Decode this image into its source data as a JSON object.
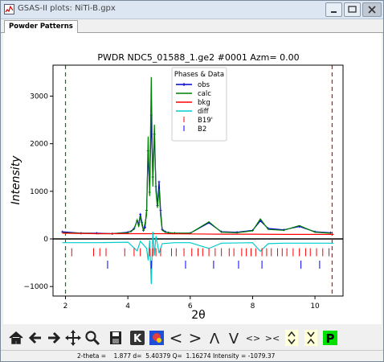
{
  "window": {
    "title": "GSAS-II plots: NiTi-B.gpx"
  },
  "tabs": [
    {
      "label": "Powder Patterns"
    }
  ],
  "toolbar": {
    "icons": [
      "home-icon",
      "back-arrow-icon",
      "forward-arrow-icon",
      "pan-icon",
      "zoom-icon",
      "save-icon",
      "key-icon",
      "color-icon",
      "shift-left-icon",
      "shift-right-icon",
      "shift-up-icon",
      "shift-down-icon",
      "expand-icon",
      "contract-icon",
      "stretch-vertical-icon",
      "squeeze-vertical-icon",
      "publish-icon"
    ],
    "labels": {
      "shift_left": "<",
      "shift_right": ">",
      "up": "Λ",
      "down": "V",
      "expand": "<>",
      "contract": "><",
      "publish": "P",
      "key": "K"
    }
  },
  "status": {
    "text": "2-theta =    1.877 d=  5.40379 Q=  1.16274 Intensity = -1079.37"
  },
  "chart_data": {
    "type": "line",
    "title": "PWDR NDC5_01588_1.ge2 #0001 Azm= 0.00",
    "xlabel": "2θ",
    "ylabel": "Intensity",
    "xlim": [
      1.6,
      10.9
    ],
    "ylim": [
      -1200,
      3650
    ],
    "xticks": [
      2,
      4,
      6,
      8,
      10
    ],
    "yticks": [
      -1000,
      0,
      1000,
      2000,
      3000
    ],
    "legend": {
      "title": "Phases & Data",
      "placement": "top-center"
    },
    "series": [
      {
        "name": "obs",
        "color": "#0000cd",
        "x": [
          1.9,
          2.5,
          3.0,
          3.5,
          4.0,
          4.1,
          4.2,
          4.3,
          4.35,
          4.4,
          4.45,
          4.5,
          4.55,
          4.6,
          4.65,
          4.7,
          4.75,
          4.8,
          4.85,
          4.9,
          4.95,
          5.0,
          5.05,
          5.1,
          5.2,
          5.3,
          5.5,
          6.0,
          6.6,
          7.0,
          7.5,
          8.0,
          8.25,
          8.5,
          9.0,
          9.5,
          10.0,
          10.5
        ],
        "y": [
          150,
          120,
          120,
          110,
          140,
          160,
          220,
          380,
          300,
          520,
          350,
          180,
          240,
          600,
          1850,
          980,
          2600,
          1300,
          2200,
          1100,
          700,
          1200,
          600,
          200,
          150,
          130,
          120,
          120,
          340,
          150,
          140,
          180,
          380,
          220,
          190,
          260,
          150,
          130
        ]
      },
      {
        "name": "calc",
        "color": "#008000",
        "x": [
          1.9,
          2.5,
          3.0,
          3.5,
          4.0,
          4.2,
          4.3,
          4.35,
          4.4,
          4.45,
          4.5,
          4.6,
          4.65,
          4.7,
          4.75,
          4.8,
          4.85,
          4.9,
          4.95,
          5.0,
          5.05,
          5.1,
          5.2,
          5.5,
          6.0,
          6.6,
          7.0,
          7.5,
          8.0,
          8.25,
          8.5,
          9.0,
          9.5,
          10.0,
          10.5
        ],
        "y": [
          130,
          120,
          110,
          110,
          130,
          200,
          400,
          250,
          480,
          300,
          170,
          500,
          2150,
          900,
          3400,
          1100,
          2400,
          1000,
          650,
          1050,
          500,
          180,
          140,
          120,
          120,
          360,
          140,
          130,
          170,
          420,
          200,
          180,
          280,
          140,
          120
        ]
      },
      {
        "name": "bkg",
        "color": "#ff0000",
        "x": [
          1.9,
          3.0,
          4.0,
          5.0,
          6.0,
          7.0,
          8.0,
          9.0,
          10.0,
          10.6
        ],
        "y": [
          120,
          110,
          110,
          110,
          105,
          100,
          100,
          95,
          95,
          95
        ]
      },
      {
        "name": "diff",
        "color": "#00cccc",
        "x": [
          1.9,
          3.0,
          4.0,
          4.3,
          4.4,
          4.6,
          4.65,
          4.7,
          4.75,
          4.8,
          4.85,
          4.9,
          5.0,
          5.1,
          5.5,
          6.0,
          6.6,
          7.0,
          8.0,
          8.25,
          8.5,
          9.0,
          10.0,
          10.6
        ],
        "y": [
          -80,
          -80,
          -70,
          -250,
          -50,
          -200,
          -450,
          -30,
          -950,
          150,
          -350,
          60,
          -300,
          -100,
          -80,
          -80,
          -200,
          -90,
          -80,
          -260,
          -100,
          -90,
          -90,
          -90
        ]
      }
    ],
    "reflections": [
      {
        "name": "B19'",
        "color": "#ff0000",
        "positions": [
          2.2,
          2.9,
          3.1,
          3.3,
          3.9,
          4.2,
          4.4,
          4.7,
          4.8,
          4.9,
          5.05,
          5.4,
          5.55,
          5.8,
          6.05,
          6.25,
          6.4,
          6.6,
          6.8,
          7.0,
          7.25,
          7.4,
          7.65,
          7.8,
          7.95,
          8.1,
          8.3,
          8.45,
          8.6,
          8.8,
          8.95,
          9.1,
          9.3,
          9.5,
          9.7,
          9.85,
          10.05,
          10.25,
          10.45
        ]
      },
      {
        "name": "B2",
        "color": "#0000ff",
        "positions": [
          3.35,
          4.75,
          5.85,
          6.75,
          7.55,
          8.3,
          9.55,
          10.15
        ]
      }
    ],
    "vlines": [
      {
        "x": 2.0,
        "color": "#008000",
        "style": "dashed"
      },
      {
        "x": 10.55,
        "color": "#ff0000",
        "style": "dashed"
      }
    ]
  }
}
